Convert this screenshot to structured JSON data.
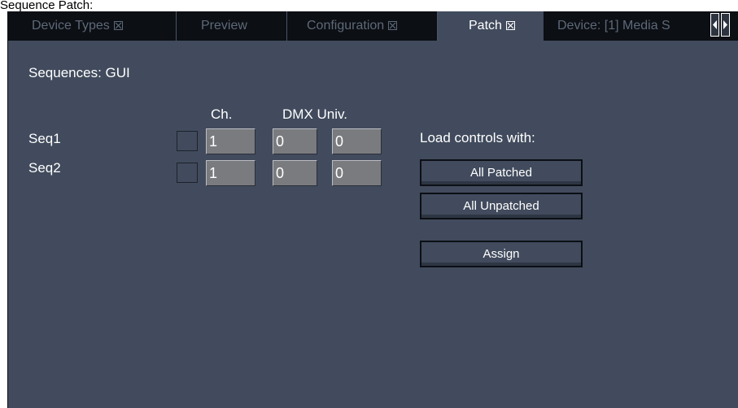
{
  "window": {
    "title": "Sequence Patch:"
  },
  "tabs": [
    {
      "label": "Device Types",
      "closable": true,
      "active": false
    },
    {
      "label": "Preview",
      "closable": false,
      "active": false
    },
    {
      "label": "Configuration",
      "closable": true,
      "active": false
    },
    {
      "label": "Patch",
      "closable": true,
      "active": true
    },
    {
      "label": "Device: [1] Media S",
      "closable": false,
      "active": false
    }
  ],
  "panel": {
    "heading": "Sequences: GUI",
    "columns": {
      "ch": "Ch.",
      "dmx_univ": "DMX Univ."
    },
    "rows": [
      {
        "name": "Seq1",
        "ch": "1",
        "dmx": "0",
        "univ": "0"
      },
      {
        "name": "Seq2",
        "ch": "1",
        "dmx": "0",
        "univ": "0"
      }
    ],
    "load_controls_label": "Load controls with:",
    "buttons": {
      "all_patched": "All Patched",
      "all_unpatched": "All Unpatched",
      "assign": "Assign"
    }
  },
  "colors": {
    "panel_bg": "#414b5d",
    "tabbar_bg": "#0c0f14",
    "field_bg": "#7a7b7f",
    "inactive_tab_text": "#5e6978"
  },
  "icons": {
    "tab_close": "close-box-icon",
    "scroll_left": "arrow-left-icon",
    "scroll_right": "arrow-right-icon"
  }
}
